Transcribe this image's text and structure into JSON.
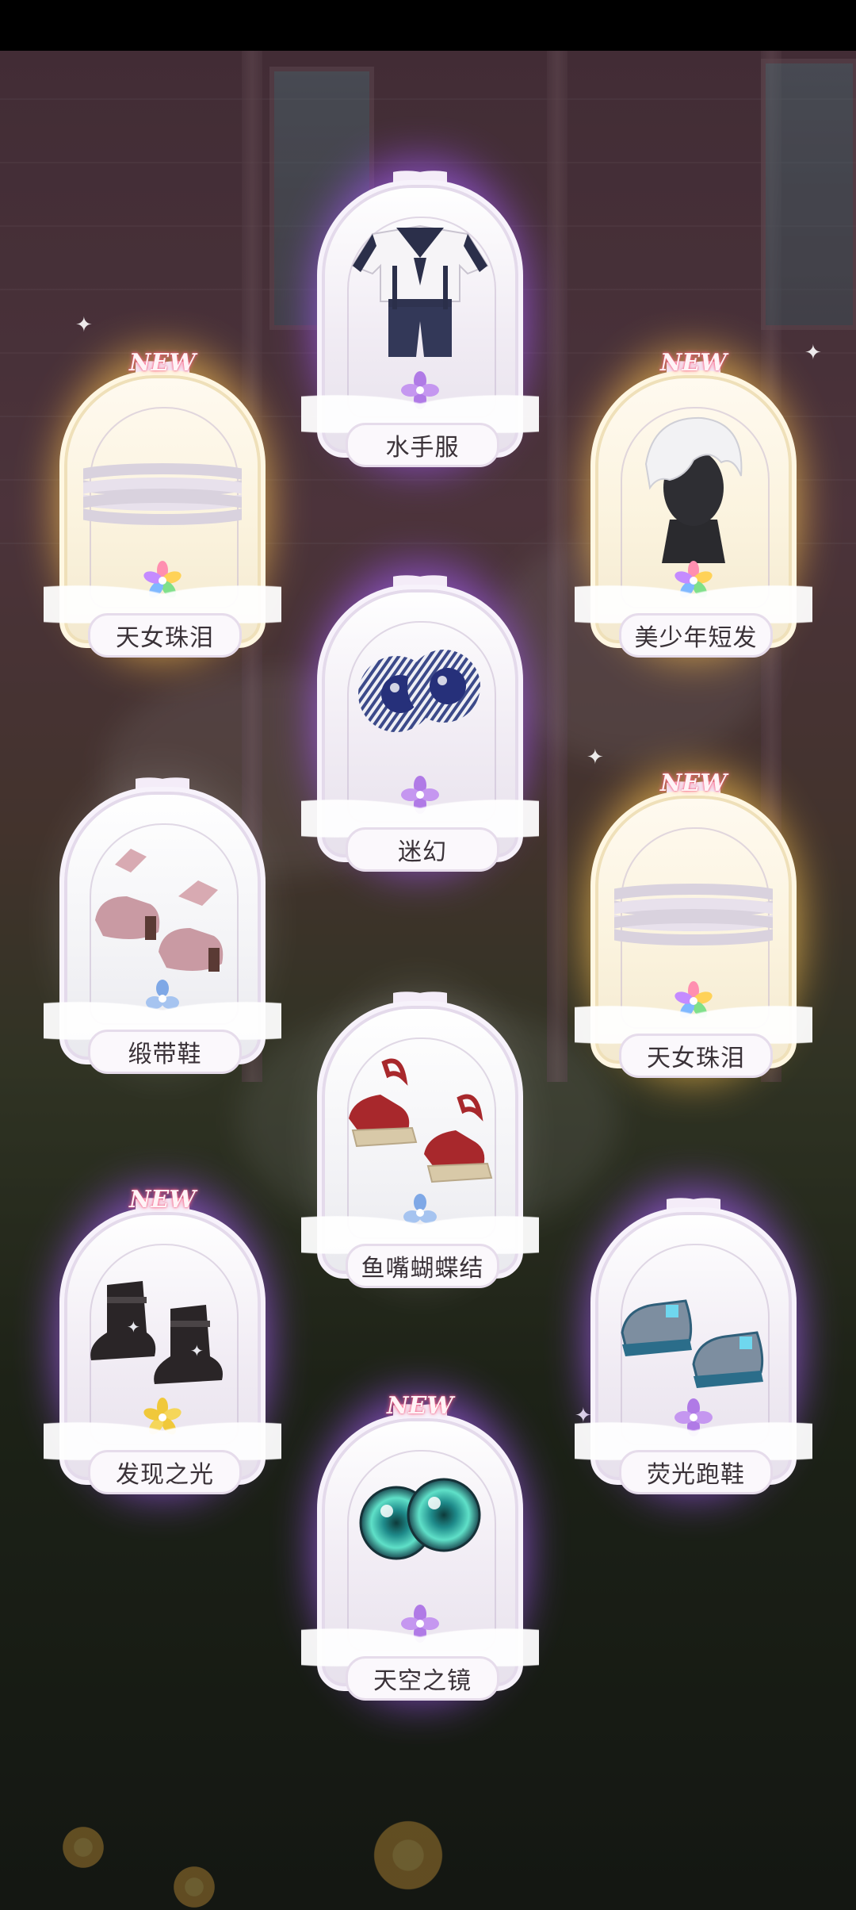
{
  "new_label": "NEW",
  "cards": [
    {
      "name": "水手服",
      "is_new": false,
      "rarity_color": "purple",
      "icon": "sailor-outfit-icon",
      "gem_color": "#b07ae6"
    },
    {
      "name": "天女珠泪",
      "is_new": true,
      "rarity_color": "gold",
      "icon": "pearl-choker-icon",
      "gem_color": "rainbow"
    },
    {
      "name": "美少年短发",
      "is_new": true,
      "rarity_color": "gold",
      "icon": "short-hair-icon",
      "gem_color": "rainbow"
    },
    {
      "name": "迷幻",
      "is_new": false,
      "rarity_color": "purple",
      "icon": "eyes-icon",
      "gem_color": "#b07ae6"
    },
    {
      "name": "缎带鞋",
      "is_new": false,
      "rarity_color": "white",
      "icon": "ribbon-shoes-icon",
      "gem_color": "#7fa8e6"
    },
    {
      "name": "天女珠泪",
      "is_new": true,
      "rarity_color": "gold",
      "icon": "pearl-choker-icon",
      "gem_color": "rainbow"
    },
    {
      "name": "鱼嘴蝴蝶结",
      "is_new": false,
      "rarity_color": "white",
      "icon": "red-sandals-icon",
      "gem_color": "#7fa8e6"
    },
    {
      "name": "发现之光",
      "is_new": true,
      "rarity_color": "purple",
      "icon": "black-boots-icon",
      "gem_color": "#f0c83a"
    },
    {
      "name": "荧光跑鞋",
      "is_new": false,
      "rarity_color": "purple",
      "icon": "glow-sneakers-icon",
      "gem_color": "#b07ae6"
    },
    {
      "name": "天空之镜",
      "is_new": true,
      "rarity_color": "purple",
      "icon": "cyan-eyes-icon",
      "gem_color": "#b07ae6"
    }
  ]
}
